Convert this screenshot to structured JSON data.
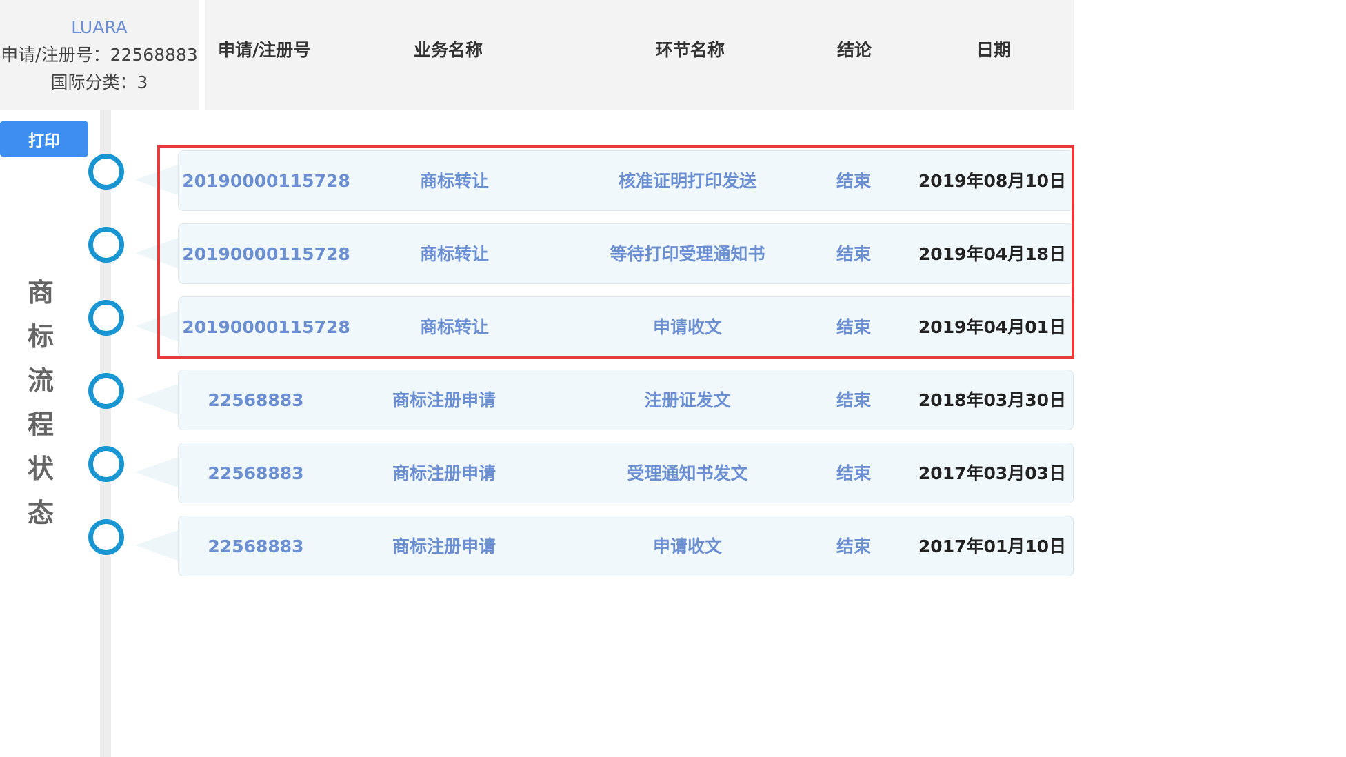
{
  "info": {
    "brand": "LUARA",
    "reg_number": "申请/注册号：22568883",
    "intl_class": "国际分类：3"
  },
  "headers": {
    "reg_no": "申请/注册号",
    "business": "业务名称",
    "stage": "环节名称",
    "conclusion": "结论",
    "date": "日期"
  },
  "print_label": "打印",
  "side_title": [
    "商",
    "标",
    "流",
    "程",
    "状",
    "态"
  ],
  "rows": [
    {
      "reg_no": "20190000115728",
      "business": "商标转让",
      "stage": "核准证明打印发送",
      "conclusion": "结束",
      "date": "2019年08月10日"
    },
    {
      "reg_no": "20190000115728",
      "business": "商标转让",
      "stage": "等待打印受理通知书",
      "conclusion": "结束",
      "date": "2019年04月18日"
    },
    {
      "reg_no": "20190000115728",
      "business": "商标转让",
      "stage": "申请收文",
      "conclusion": "结束",
      "date": "2019年04月01日"
    },
    {
      "reg_no": "22568883",
      "business": "商标注册申请",
      "stage": "注册证发文",
      "conclusion": "结束",
      "date": "2018年03月30日"
    },
    {
      "reg_no": "22568883",
      "business": "商标注册申请",
      "stage": "受理通知书发文",
      "conclusion": "结束",
      "date": "2017年03月03日"
    },
    {
      "reg_no": "22568883",
      "business": "商标注册申请",
      "stage": "申请收文",
      "conclusion": "结束",
      "date": "2017年01月10日"
    }
  ],
  "colors": {
    "accent_blue": "#6c8fd2",
    "timeline_blue": "#1996d2",
    "print_button": "#3d8ef0",
    "highlight_red": "#e83a3a"
  }
}
